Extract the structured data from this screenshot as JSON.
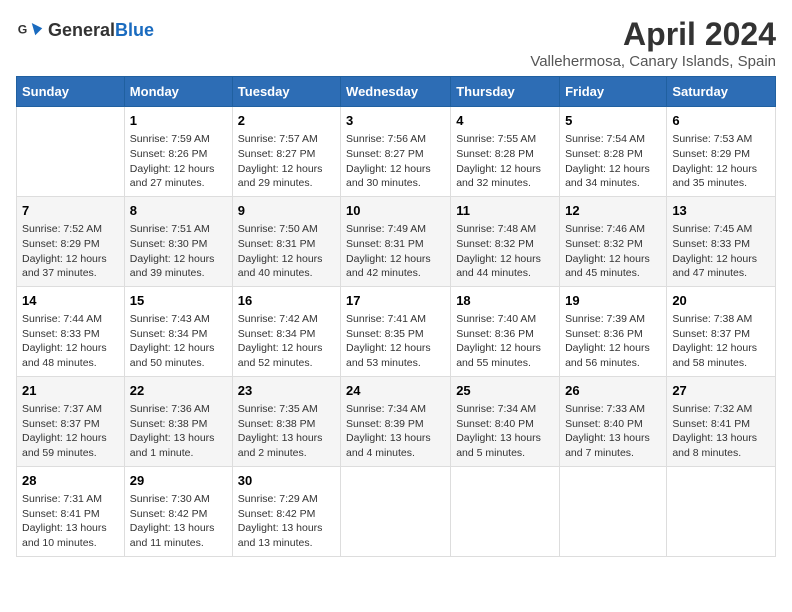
{
  "header": {
    "logo_general": "General",
    "logo_blue": "Blue",
    "title": "April 2024",
    "subtitle": "Vallehermosa, Canary Islands, Spain"
  },
  "days_of_week": [
    "Sunday",
    "Monday",
    "Tuesday",
    "Wednesday",
    "Thursday",
    "Friday",
    "Saturday"
  ],
  "weeks": [
    [
      {
        "day": "",
        "content": ""
      },
      {
        "day": "1",
        "content": "Sunrise: 7:59 AM\nSunset: 8:26 PM\nDaylight: 12 hours and 27 minutes."
      },
      {
        "day": "2",
        "content": "Sunrise: 7:57 AM\nSunset: 8:27 PM\nDaylight: 12 hours and 29 minutes."
      },
      {
        "day": "3",
        "content": "Sunrise: 7:56 AM\nSunset: 8:27 PM\nDaylight: 12 hours and 30 minutes."
      },
      {
        "day": "4",
        "content": "Sunrise: 7:55 AM\nSunset: 8:28 PM\nDaylight: 12 hours and 32 minutes."
      },
      {
        "day": "5",
        "content": "Sunrise: 7:54 AM\nSunset: 8:28 PM\nDaylight: 12 hours and 34 minutes."
      },
      {
        "day": "6",
        "content": "Sunrise: 7:53 AM\nSunset: 8:29 PM\nDaylight: 12 hours and 35 minutes."
      }
    ],
    [
      {
        "day": "7",
        "content": "Sunrise: 7:52 AM\nSunset: 8:29 PM\nDaylight: 12 hours and 37 minutes."
      },
      {
        "day": "8",
        "content": "Sunrise: 7:51 AM\nSunset: 8:30 PM\nDaylight: 12 hours and 39 minutes."
      },
      {
        "day": "9",
        "content": "Sunrise: 7:50 AM\nSunset: 8:31 PM\nDaylight: 12 hours and 40 minutes."
      },
      {
        "day": "10",
        "content": "Sunrise: 7:49 AM\nSunset: 8:31 PM\nDaylight: 12 hours and 42 minutes."
      },
      {
        "day": "11",
        "content": "Sunrise: 7:48 AM\nSunset: 8:32 PM\nDaylight: 12 hours and 44 minutes."
      },
      {
        "day": "12",
        "content": "Sunrise: 7:46 AM\nSunset: 8:32 PM\nDaylight: 12 hours and 45 minutes."
      },
      {
        "day": "13",
        "content": "Sunrise: 7:45 AM\nSunset: 8:33 PM\nDaylight: 12 hours and 47 minutes."
      }
    ],
    [
      {
        "day": "14",
        "content": "Sunrise: 7:44 AM\nSunset: 8:33 PM\nDaylight: 12 hours and 48 minutes."
      },
      {
        "day": "15",
        "content": "Sunrise: 7:43 AM\nSunset: 8:34 PM\nDaylight: 12 hours and 50 minutes."
      },
      {
        "day": "16",
        "content": "Sunrise: 7:42 AM\nSunset: 8:34 PM\nDaylight: 12 hours and 52 minutes."
      },
      {
        "day": "17",
        "content": "Sunrise: 7:41 AM\nSunset: 8:35 PM\nDaylight: 12 hours and 53 minutes."
      },
      {
        "day": "18",
        "content": "Sunrise: 7:40 AM\nSunset: 8:36 PM\nDaylight: 12 hours and 55 minutes."
      },
      {
        "day": "19",
        "content": "Sunrise: 7:39 AM\nSunset: 8:36 PM\nDaylight: 12 hours and 56 minutes."
      },
      {
        "day": "20",
        "content": "Sunrise: 7:38 AM\nSunset: 8:37 PM\nDaylight: 12 hours and 58 minutes."
      }
    ],
    [
      {
        "day": "21",
        "content": "Sunrise: 7:37 AM\nSunset: 8:37 PM\nDaylight: 12 hours and 59 minutes."
      },
      {
        "day": "22",
        "content": "Sunrise: 7:36 AM\nSunset: 8:38 PM\nDaylight: 13 hours and 1 minute."
      },
      {
        "day": "23",
        "content": "Sunrise: 7:35 AM\nSunset: 8:38 PM\nDaylight: 13 hours and 2 minutes."
      },
      {
        "day": "24",
        "content": "Sunrise: 7:34 AM\nSunset: 8:39 PM\nDaylight: 13 hours and 4 minutes."
      },
      {
        "day": "25",
        "content": "Sunrise: 7:34 AM\nSunset: 8:40 PM\nDaylight: 13 hours and 5 minutes."
      },
      {
        "day": "26",
        "content": "Sunrise: 7:33 AM\nSunset: 8:40 PM\nDaylight: 13 hours and 7 minutes."
      },
      {
        "day": "27",
        "content": "Sunrise: 7:32 AM\nSunset: 8:41 PM\nDaylight: 13 hours and 8 minutes."
      }
    ],
    [
      {
        "day": "28",
        "content": "Sunrise: 7:31 AM\nSunset: 8:41 PM\nDaylight: 13 hours and 10 minutes."
      },
      {
        "day": "29",
        "content": "Sunrise: 7:30 AM\nSunset: 8:42 PM\nDaylight: 13 hours and 11 minutes."
      },
      {
        "day": "30",
        "content": "Sunrise: 7:29 AM\nSunset: 8:42 PM\nDaylight: 13 hours and 13 minutes."
      },
      {
        "day": "",
        "content": ""
      },
      {
        "day": "",
        "content": ""
      },
      {
        "day": "",
        "content": ""
      },
      {
        "day": "",
        "content": ""
      }
    ]
  ]
}
